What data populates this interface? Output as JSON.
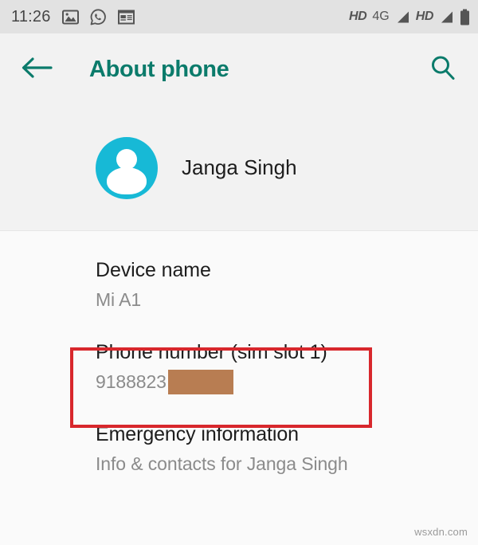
{
  "status_bar": {
    "time": "11:26",
    "left_icons": [
      {
        "name": "image-icon",
        "glyph": "image"
      },
      {
        "name": "whatsapp-icon",
        "glyph": "whatsapp"
      },
      {
        "name": "news-app-icon",
        "glyph": "news"
      }
    ],
    "right": {
      "hd_label_1": "HD",
      "network_label": "4G",
      "hd_label_2": "HD",
      "signal_icon_1": "signal-bars-icon",
      "signal_icon_2": "signal-bars-icon",
      "battery_icon": "battery-full-icon"
    }
  },
  "app_bar": {
    "back_icon": "arrow-left-icon",
    "title": "About phone",
    "search_icon": "search-icon",
    "accent_color": "#0b7b6b"
  },
  "account": {
    "avatar_icon": "person-avatar-icon",
    "avatar_color": "#17b9d6",
    "name": "Janga Singh"
  },
  "items": [
    {
      "name": "device-name",
      "title": "Device name",
      "subtitle": "Mi A1",
      "highlighted": false
    },
    {
      "name": "phone-number-sim-slot-1",
      "title": "Phone number (sim slot 1)",
      "subtitle": "9188823",
      "redacted": true,
      "redaction_color": "#b87d52",
      "highlighted": true,
      "highlight_color": "#d8272c"
    },
    {
      "name": "emergency-information",
      "title": "Emergency information",
      "subtitle": "Info & contacts for Janga Singh",
      "highlighted": false
    }
  ],
  "watermark": "wsxdn.com"
}
